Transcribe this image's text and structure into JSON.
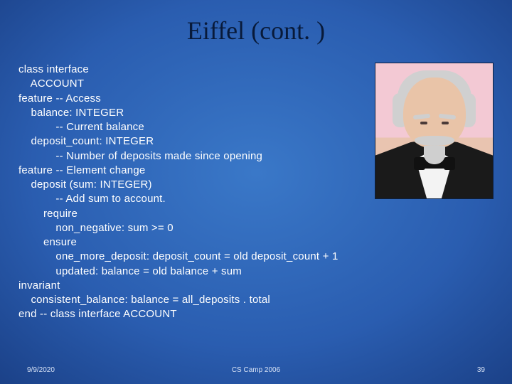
{
  "title": "Eiffel (cont. )",
  "code": {
    "l1": "class interface",
    "l2": "    ACCOUNT",
    "l3": "feature -- Access",
    "l4": "    balance: INTEGER",
    "l5": "            -- Current balance",
    "l6": "    deposit_count: INTEGER",
    "l7": "            -- Number of deposits made since opening",
    "l8": "feature -- Element change",
    "l9": "    deposit (sum: INTEGER)",
    "l10": "            -- Add sum to account.",
    "l11": "        require",
    "l12": "            non_negative: sum >= 0",
    "l13": "        ensure",
    "l14": "            one_more_deposit: deposit_count = old deposit_count + 1",
    "l15": "            updated: balance = old balance + sum",
    "l16": "invariant",
    "l17": "    consistent_balance: balance = all_deposits . total",
    "l18": "end -- class interface ACCOUNT"
  },
  "footer": {
    "date": "9/9/2020",
    "center": "CS Camp 2006",
    "page": "39"
  }
}
